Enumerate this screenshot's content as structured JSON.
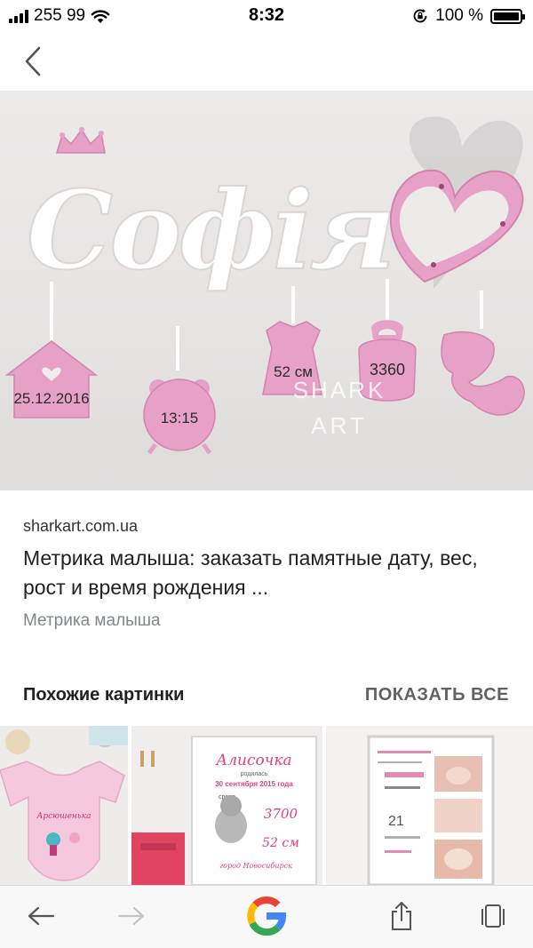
{
  "status_bar": {
    "carrier": "255 99",
    "time": "8:32",
    "battery": "100 %",
    "battery_level": 1.0
  },
  "hero": {
    "name_text": "Софія",
    "tags": [
      "25.12.2016",
      "13:15",
      "52 см",
      "3360"
    ],
    "watermark_line1": "SHARK",
    "watermark_line2": "ART"
  },
  "result": {
    "source": "sharkart.com.ua",
    "title": "Метрика малыша: заказать памятные дату, вес, рост и время рождения ...",
    "subtitle": "Метрика малыша"
  },
  "similar": {
    "label": "Похожие картинки",
    "show_all": "ПОКАЗАТЬ ВСЕ"
  },
  "thumbnails": [
    {
      "name": "baby-bodysuit",
      "text": "Арсюшенька"
    },
    {
      "name": "metric-poster-pink",
      "lines": [
        "Алисочка",
        "родилась",
        "30 сентября 2015 года",
        "среда",
        "3700",
        "52 см",
        "город Новосибирск"
      ]
    },
    {
      "name": "metric-poster-photos",
      "number": "21"
    }
  ],
  "colors": {
    "pink": "#e7a1c6",
    "pink_dark": "#d483ad",
    "link_gray": "#80868b",
    "google_blue": "#4285f4",
    "google_red": "#ea4335",
    "google_yellow": "#fbbc05",
    "google_green": "#34a853"
  },
  "icons": {
    "back": "chevron-left-icon",
    "nav_back": "arrow-left-icon",
    "nav_forward": "arrow-right-icon",
    "home": "google-g-icon",
    "share": "share-icon",
    "tabs": "tabs-icon"
  }
}
